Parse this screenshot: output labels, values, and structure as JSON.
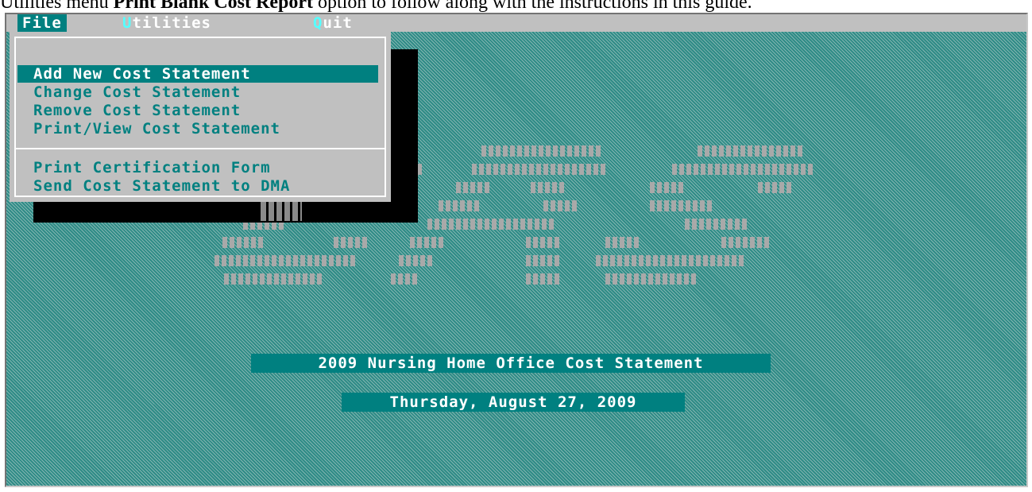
{
  "caption": {
    "prefix": "Utilities menu ",
    "bold": "Print Blank Cost Report",
    "suffix": " option to follow along with the instructions in this guide."
  },
  "menu_bar": {
    "file": "File",
    "utilities": {
      "hotkey": "U",
      "rest": "tilities"
    },
    "quit": {
      "hotkey": "Q",
      "rest": "uit"
    }
  },
  "dropdown": {
    "items": [
      "Add New Cost Statement",
      "Change Cost Statement",
      "Remove Cost Statement",
      "Print/View Cost Statement",
      "Print Certification Form",
      "Send Cost Statement to DMA"
    ],
    "selected_index": 0
  },
  "logo": {
    "text": "cRs",
    "color": "#a9a9a9"
  },
  "banners": {
    "title": "2009 Nursing Home Office Cost Statement",
    "date": "Thursday, August 27, 2009"
  },
  "colors": {
    "teal": "#008080",
    "menu_gray": "#c0c0c0",
    "hotkey": "#55ffff"
  }
}
